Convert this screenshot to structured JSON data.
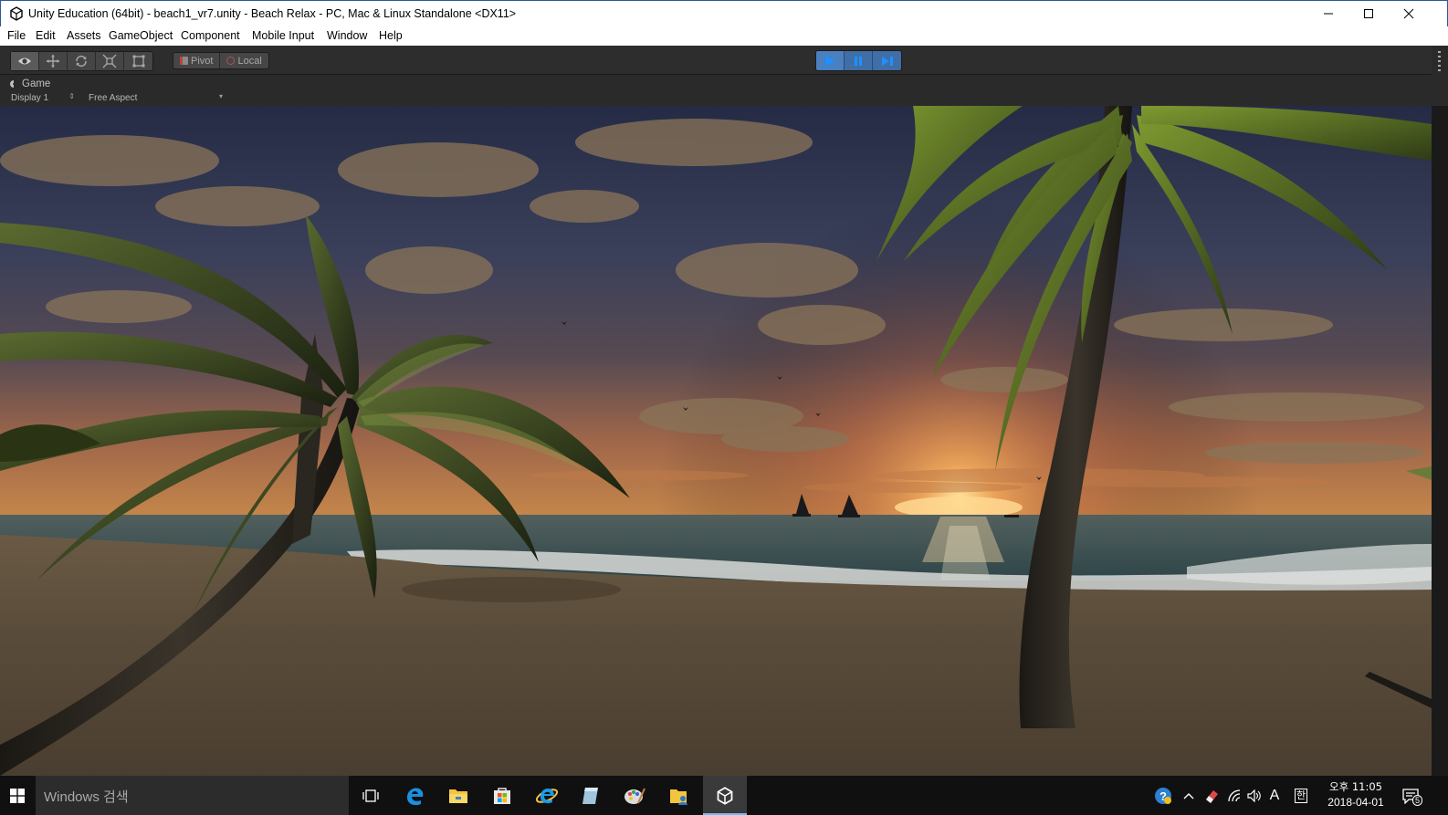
{
  "window": {
    "title": "Unity Education (64bit) - beach1_vr7.unity - Beach Relax - PC, Mac & Linux Standalone <DX11>"
  },
  "menu": {
    "items": [
      "File",
      "Edit",
      "Assets",
      "GameObject",
      "Component",
      "Mobile Input",
      "Window",
      "Help"
    ]
  },
  "toolbar": {
    "pivot_label": "Pivot",
    "local_label": "Local",
    "tools": [
      "view-tool",
      "move-tool",
      "rotate-tool",
      "scale-tool",
      "rect-tool"
    ],
    "play_state": "playing"
  },
  "game_view": {
    "tab_label": "Game",
    "display": "Display 1",
    "aspect": "Free Aspect",
    "scene": "Tropical beach at sunset with palm trees and two sailboats on the sea"
  },
  "taskbar": {
    "search_placeholder": "Windows 검색",
    "pinned": [
      "task-view",
      "edge",
      "file-explorer",
      "store",
      "internet-explorer",
      "app-notepad",
      "app-paint",
      "app-folder-user",
      "unity"
    ],
    "clock_time": "오후 11:05",
    "clock_date": "2018-04-01",
    "notification_count": "5",
    "ime_indicator": "A",
    "ime_mode": "한"
  },
  "colors": {
    "accent": "#76b9ed",
    "play_active": "#4a7fc0",
    "toolbar_bg": "#2d2d2d"
  }
}
